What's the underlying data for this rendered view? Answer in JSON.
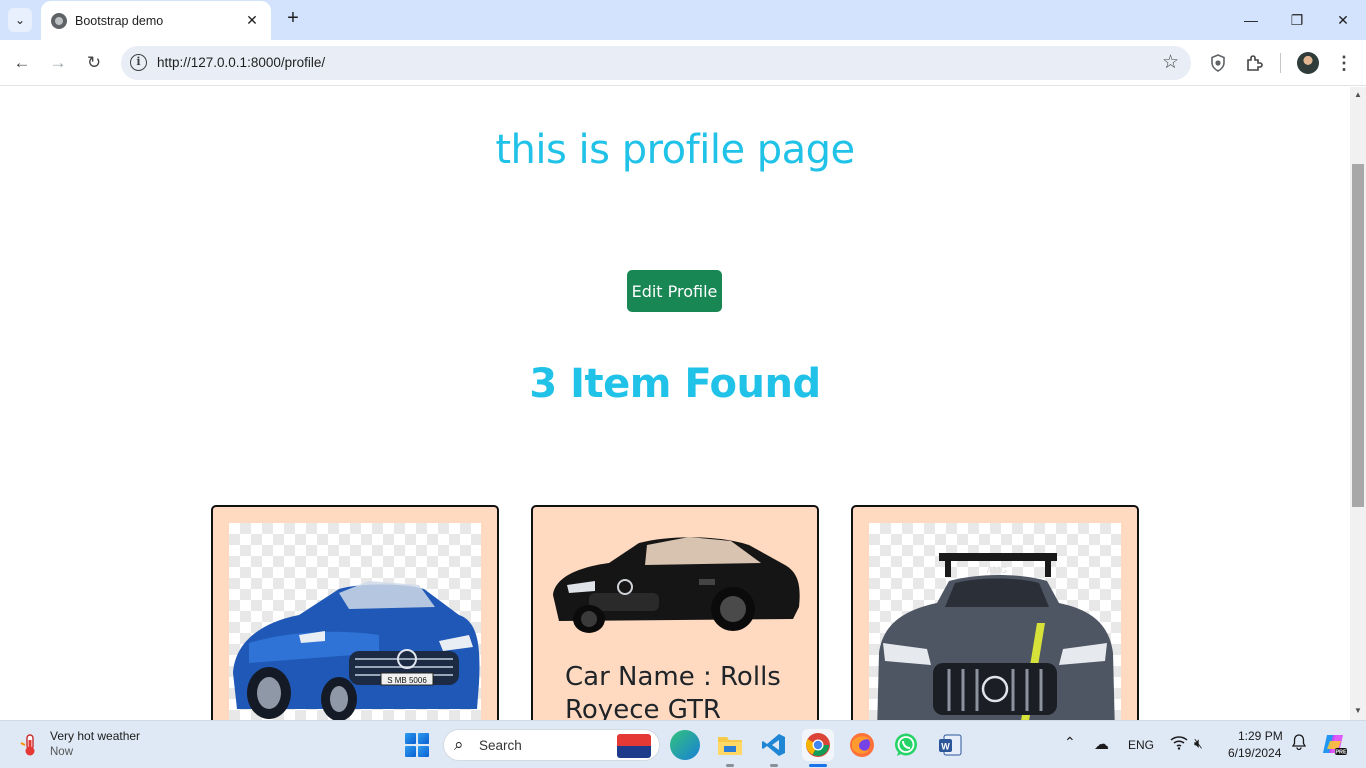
{
  "browser": {
    "tab_title": "Bootstrap demo",
    "url": "http://127.0.0.1:8000/profile/"
  },
  "page": {
    "title": "this is profile page",
    "edit_button": "Edit Profile",
    "items_found": "3 Item Found",
    "cards": [
      {
        "name": "",
        "image": "blue-convertible-car"
      },
      {
        "name": "Car Name : Rolls Royece   GTR",
        "image": "black-coupe-car"
      },
      {
        "name": "",
        "image": "grey-race-car"
      }
    ]
  },
  "taskbar": {
    "weather_title": "Very hot weather",
    "weather_sub": "Now",
    "search_label": "Search",
    "language": "ENG",
    "time": "1:29 PM",
    "date": "6/19/2024"
  },
  "colors": {
    "heading": "#20c2e8",
    "button": "#198754",
    "card_bg": "#ffdac0"
  }
}
